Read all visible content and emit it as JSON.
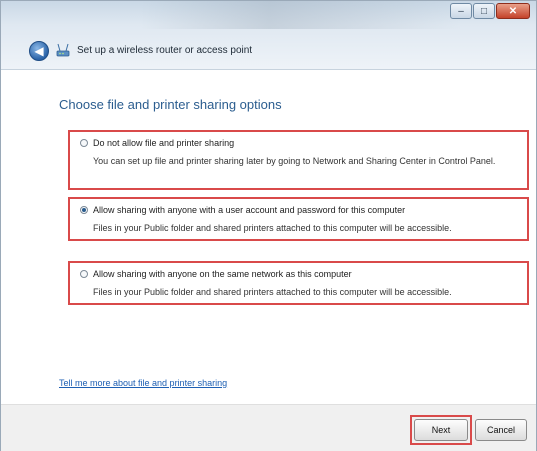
{
  "window": {
    "title": "Set up a wireless router or access point",
    "buttons": {
      "minimize": "–",
      "maximize": "□",
      "close": "✕"
    }
  },
  "icons": {
    "back": "back-arrow-icon",
    "app": "network-setup-icon"
  },
  "page": {
    "heading": "Choose file and printer sharing options",
    "options": [
      {
        "label": "Do not allow file and printer sharing",
        "description": "You can set up file and printer sharing later by going to Network and Sharing Center in Control Panel.",
        "selected": false
      },
      {
        "label": "Allow sharing with anyone with a user account and password for this computer",
        "description": "Files in your Public folder and shared printers attached to this computer will be accessible.",
        "selected": true
      },
      {
        "label": "Allow sharing with anyone on the same network as this computer",
        "description": "Files in your Public folder and shared printers attached to this computer will be accessible.",
        "selected": false
      }
    ],
    "help_link": "Tell me more about file and printer sharing"
  },
  "footer": {
    "next_label": "Next",
    "cancel_label": "Cancel"
  },
  "colors": {
    "highlight": "#d94a4a",
    "heading": "#2b5d8f",
    "link": "#1d5fb3"
  }
}
